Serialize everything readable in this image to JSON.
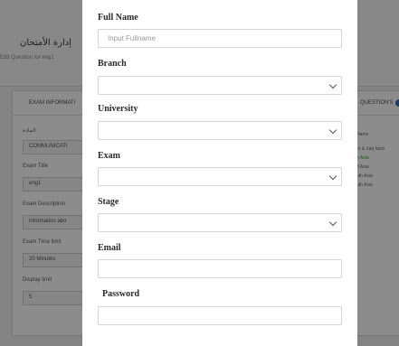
{
  "background": {
    "page_title": "إدارة الأمتحان",
    "page_subtitle": "Edit Question for eng1",
    "left_tab": "EXAM INFORMATI",
    "right_tab": "QUESTION'S",
    "fields": [
      {
        "label": "المادة",
        "value": "COMMUNICATI"
      },
      {
        "label": "Exam Title",
        "value": "eng1"
      },
      {
        "label": "Exam Description",
        "value": "information abo"
      },
      {
        "label": "Exam Time limit",
        "value": "20 Minutes"
      },
      {
        "label": "Display limit",
        "value": "5"
      }
    ],
    "right_lines": [
      {
        "text": "Name",
        "color": "#555555"
      },
      {
        "text": "re & Iraq facts",
        "color": "#333333"
      },
      {
        "text": "h Asia",
        "color": "#3a9a3a"
      },
      {
        "text": "d Asia",
        "color": "#555555"
      },
      {
        "text": "uth Asia",
        "color": "#555555"
      },
      {
        "text": "uth Asia",
        "color": "#555555"
      }
    ]
  },
  "modal": {
    "full_name": {
      "label": "Full Name",
      "placeholder": "Input Fullname"
    },
    "branch": {
      "label": "Branch",
      "value": ""
    },
    "university": {
      "label": "University",
      "value": ""
    },
    "exam": {
      "label": "Exam",
      "value": ""
    },
    "stage": {
      "label": "Stage",
      "value": ""
    },
    "email": {
      "label": "Email",
      "value": ""
    },
    "password": {
      "label": "Password",
      "value": ""
    }
  }
}
